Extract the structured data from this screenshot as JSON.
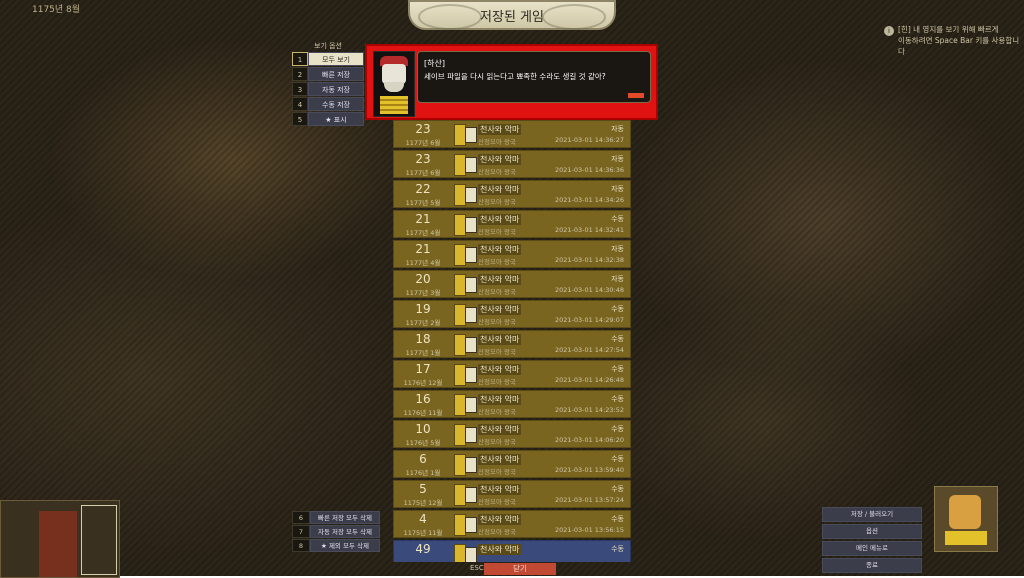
{
  "top": {
    "date": "1175년 8월",
    "subdate": ""
  },
  "banner": {
    "title": "저장된 게임"
  },
  "hint": {
    "icon": "info-icon",
    "lines": [
      "[힌] 내 영지를 보기 위해 빠르게",
      "이동하려면 Space Bar 키를 사용합니다"
    ]
  },
  "view_options": {
    "header": "보기 옵션",
    "items": [
      {
        "key": "1",
        "label": "모두 보기",
        "selected": true
      },
      {
        "key": "2",
        "label": "빠른 저장",
        "selected": false
      },
      {
        "key": "3",
        "label": "자동 저장",
        "selected": false
      },
      {
        "key": "4",
        "label": "수동 저장",
        "selected": false
      },
      {
        "key": "5",
        "label": "★ 표시",
        "selected": false
      }
    ]
  },
  "dialog": {
    "speaker": "[하산]",
    "text": "세이브 파일을 다시 읽는다고 뾰족한 수라도 생길 것 같아?"
  },
  "saves": [
    {
      "num": "23",
      "date": "1177년 6월",
      "title": "천사와 악마",
      "sub": "산정모아 왕국",
      "kind": "자동",
      "time": "2021-03-01 14:36:27"
    },
    {
      "num": "23",
      "date": "1177년 6월",
      "title": "천사와 악마",
      "sub": "산정모아 왕국",
      "kind": "자동",
      "time": "2021-03-01 14:36:36"
    },
    {
      "num": "22",
      "date": "1177년 5월",
      "title": "천사와 악마",
      "sub": "산정모아 왕국",
      "kind": "자동",
      "time": "2021-03-01 14:34:26"
    },
    {
      "num": "21",
      "date": "1177년 4월",
      "title": "천사와 악마",
      "sub": "산정모아 왕국",
      "kind": "수동",
      "time": "2021-03-01 14:32:41"
    },
    {
      "num": "21",
      "date": "1177년 4월",
      "title": "천사와 악마",
      "sub": "산정모아 왕국",
      "kind": "자동",
      "time": "2021-03-01 14:32:38"
    },
    {
      "num": "20",
      "date": "1177년 3월",
      "title": "천사와 악마",
      "sub": "산정모아 왕국",
      "kind": "자동",
      "time": "2021-03-01 14:30:48"
    },
    {
      "num": "19",
      "date": "1177년 2월",
      "title": "천사와 악마",
      "sub": "산정모아 왕국",
      "kind": "수동",
      "time": "2021-03-01 14:29:07"
    },
    {
      "num": "18",
      "date": "1177년 1월",
      "title": "천사와 악마",
      "sub": "산정모아 왕국",
      "kind": "수동",
      "time": "2021-03-01 14:27:54"
    },
    {
      "num": "17",
      "date": "1176년 12월",
      "title": "천사와 악마",
      "sub": "산정모아 왕국",
      "kind": "수동",
      "time": "2021-03-01 14:26:48"
    },
    {
      "num": "16",
      "date": "1176년 11월",
      "title": "천사와 악마",
      "sub": "산정모아 왕국",
      "kind": "수동",
      "time": "2021-03-01 14:23:52"
    },
    {
      "num": "10",
      "date": "1176년 5월",
      "title": "천사와 악마",
      "sub": "산정모아 왕국",
      "kind": "수동",
      "time": "2021-03-01 14:06:20"
    },
    {
      "num": "6",
      "date": "1176년 1월",
      "title": "천사와 악마",
      "sub": "산정모아 왕국",
      "kind": "수동",
      "time": "2021-03-01 13:59:40"
    },
    {
      "num": "5",
      "date": "1175년 12월",
      "title": "천사와 악마",
      "sub": "산정모아 왕국",
      "kind": "수동",
      "time": "2021-03-01 13:57:24"
    },
    {
      "num": "4",
      "date": "1175년 11월",
      "title": "천사와 악마",
      "sub": "산정모아 왕국",
      "kind": "수동",
      "time": "2021-03-01 13:56:15"
    },
    {
      "num": "49",
      "date": "",
      "title": "천사와 악마",
      "sub": "",
      "kind": "수동",
      "time": "",
      "blue": true
    }
  ],
  "delete_panel": [
    {
      "key": "6",
      "label": "빠른 저장 모두 삭제"
    },
    {
      "key": "7",
      "label": "자동 저장 모두 삭제"
    },
    {
      "key": "8",
      "label": "★ 제외 모두 삭제"
    }
  ],
  "bottom": {
    "esc": "ESC",
    "close": "닫기"
  },
  "right_menu": [
    "저장 / 불러오기",
    "옵션",
    "메인 메뉴로",
    "종료"
  ],
  "colors": {
    "dialog_frame": "#e01212",
    "row_gold": "#7a6520",
    "close_button": "#c24a34"
  }
}
